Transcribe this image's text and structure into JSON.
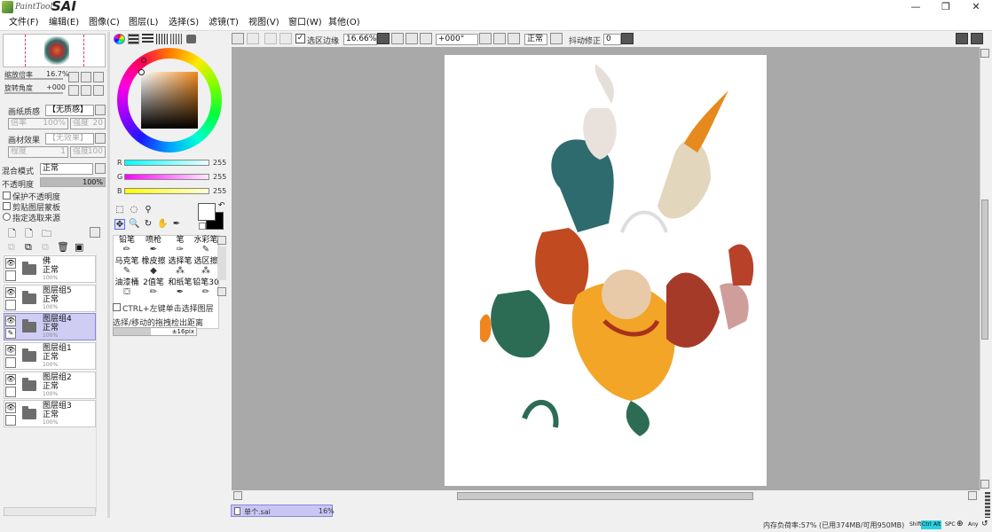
{
  "app": {
    "logo_text": "PaintTool",
    "logo_brand": "SAI"
  },
  "window_controls": {
    "minimize": "—",
    "maximize": "❐",
    "close": "✕"
  },
  "menu": [
    "文件(F)",
    "编辑(E)",
    "图像(C)",
    "图层(L)",
    "选择(S)",
    "滤镜(T)",
    "视图(V)",
    "窗口(W)",
    "其他(O)"
  ],
  "toolbar": {
    "selection_edge_label": "选区边缘",
    "selection_edge_checked": true,
    "zoom": "16.66%",
    "rotation": "+000°",
    "blend_mode": "正常",
    "stabilizer_label": "抖动修正",
    "stabilizer_value": "0"
  },
  "navigator": {
    "zoom_label": "缩放倍率",
    "zoom_value": "16.7%",
    "rotation_label": "旋转角度",
    "rotation_value": "+000"
  },
  "paper_texture": {
    "label": "画纸质感",
    "value": "【无质感】",
    "scale_label": "倍率",
    "scale_value": "100%",
    "strength_label": "强度",
    "strength_value": "20"
  },
  "paper_effect": {
    "label": "画材效果",
    "value": "【无效果】",
    "width_label": "程度",
    "width_value": "1",
    "strength_label": "强度",
    "strength_value": "100"
  },
  "layer_props": {
    "blend_label": "混合模式",
    "blend_value": "正常",
    "opacity_label": "不透明度",
    "opacity_value": "100%",
    "opacity_fraction": 1.0,
    "protect_opacity": "保护不透明度",
    "clipping_group": "剪贴图层蒙板",
    "selection_source": "指定选取来源"
  },
  "layers": [
    {
      "name": "佛",
      "mode": "正常",
      "opacity": "100%",
      "selected": false
    },
    {
      "name": "图层组5",
      "mode": "正常",
      "opacity": "100%",
      "selected": false
    },
    {
      "name": "图层组4",
      "mode": "正常",
      "opacity": "100%",
      "selected": true
    },
    {
      "name": "图层组1",
      "mode": "正常",
      "opacity": "100%",
      "selected": false
    },
    {
      "name": "图层组2",
      "mode": "正常",
      "opacity": "100%",
      "selected": false
    },
    {
      "name": "图层组3",
      "mode": "正常",
      "opacity": "100%",
      "selected": false
    }
  ],
  "color": {
    "r_label": "R",
    "r_value": "255",
    "g_label": "G",
    "g_value": "255",
    "b_label": "B",
    "b_value": "255",
    "primary": "#ffffff",
    "secondary": "#000000",
    "wheel_hue": "#f08a1e"
  },
  "tools_icons": [
    "rect-select-icon",
    "lasso-icon",
    "magic-wand-icon",
    "move-icon",
    "zoom-icon",
    "rotate-icon",
    "hand-icon",
    "eyedropper-icon"
  ],
  "brushes": [
    [
      "铅笔",
      "喷枪",
      "笔",
      "水彩笔"
    ],
    [
      "马克笔",
      "橡皮擦",
      "选择笔",
      "选区擦"
    ],
    [
      "油漆桶",
      "2值笔",
      "和纸笔",
      "铅笔30"
    ]
  ],
  "tool_options": {
    "ctrl_label": "CTRL+左键单击选择图层",
    "drag_label": "选择/移动的拖拽检出距离",
    "drag_value": "±16pix"
  },
  "document_tab": {
    "name": "单个.sai",
    "zoom": "16%"
  },
  "status": {
    "memory": "内存负荷率:57% (已用374MB/可用950MB)",
    "keys": [
      {
        "label": "Shift",
        "on": false
      },
      {
        "label": "Ctrl",
        "on": true
      },
      {
        "label": "Alt",
        "on": true
      },
      {
        "label": "SPC",
        "on": false
      },
      {
        "label": "Any",
        "on": false
      }
    ]
  },
  "colors": {
    "accent_selected": "#cfcdf3",
    "canvas_bg": "#a9a9a9"
  }
}
